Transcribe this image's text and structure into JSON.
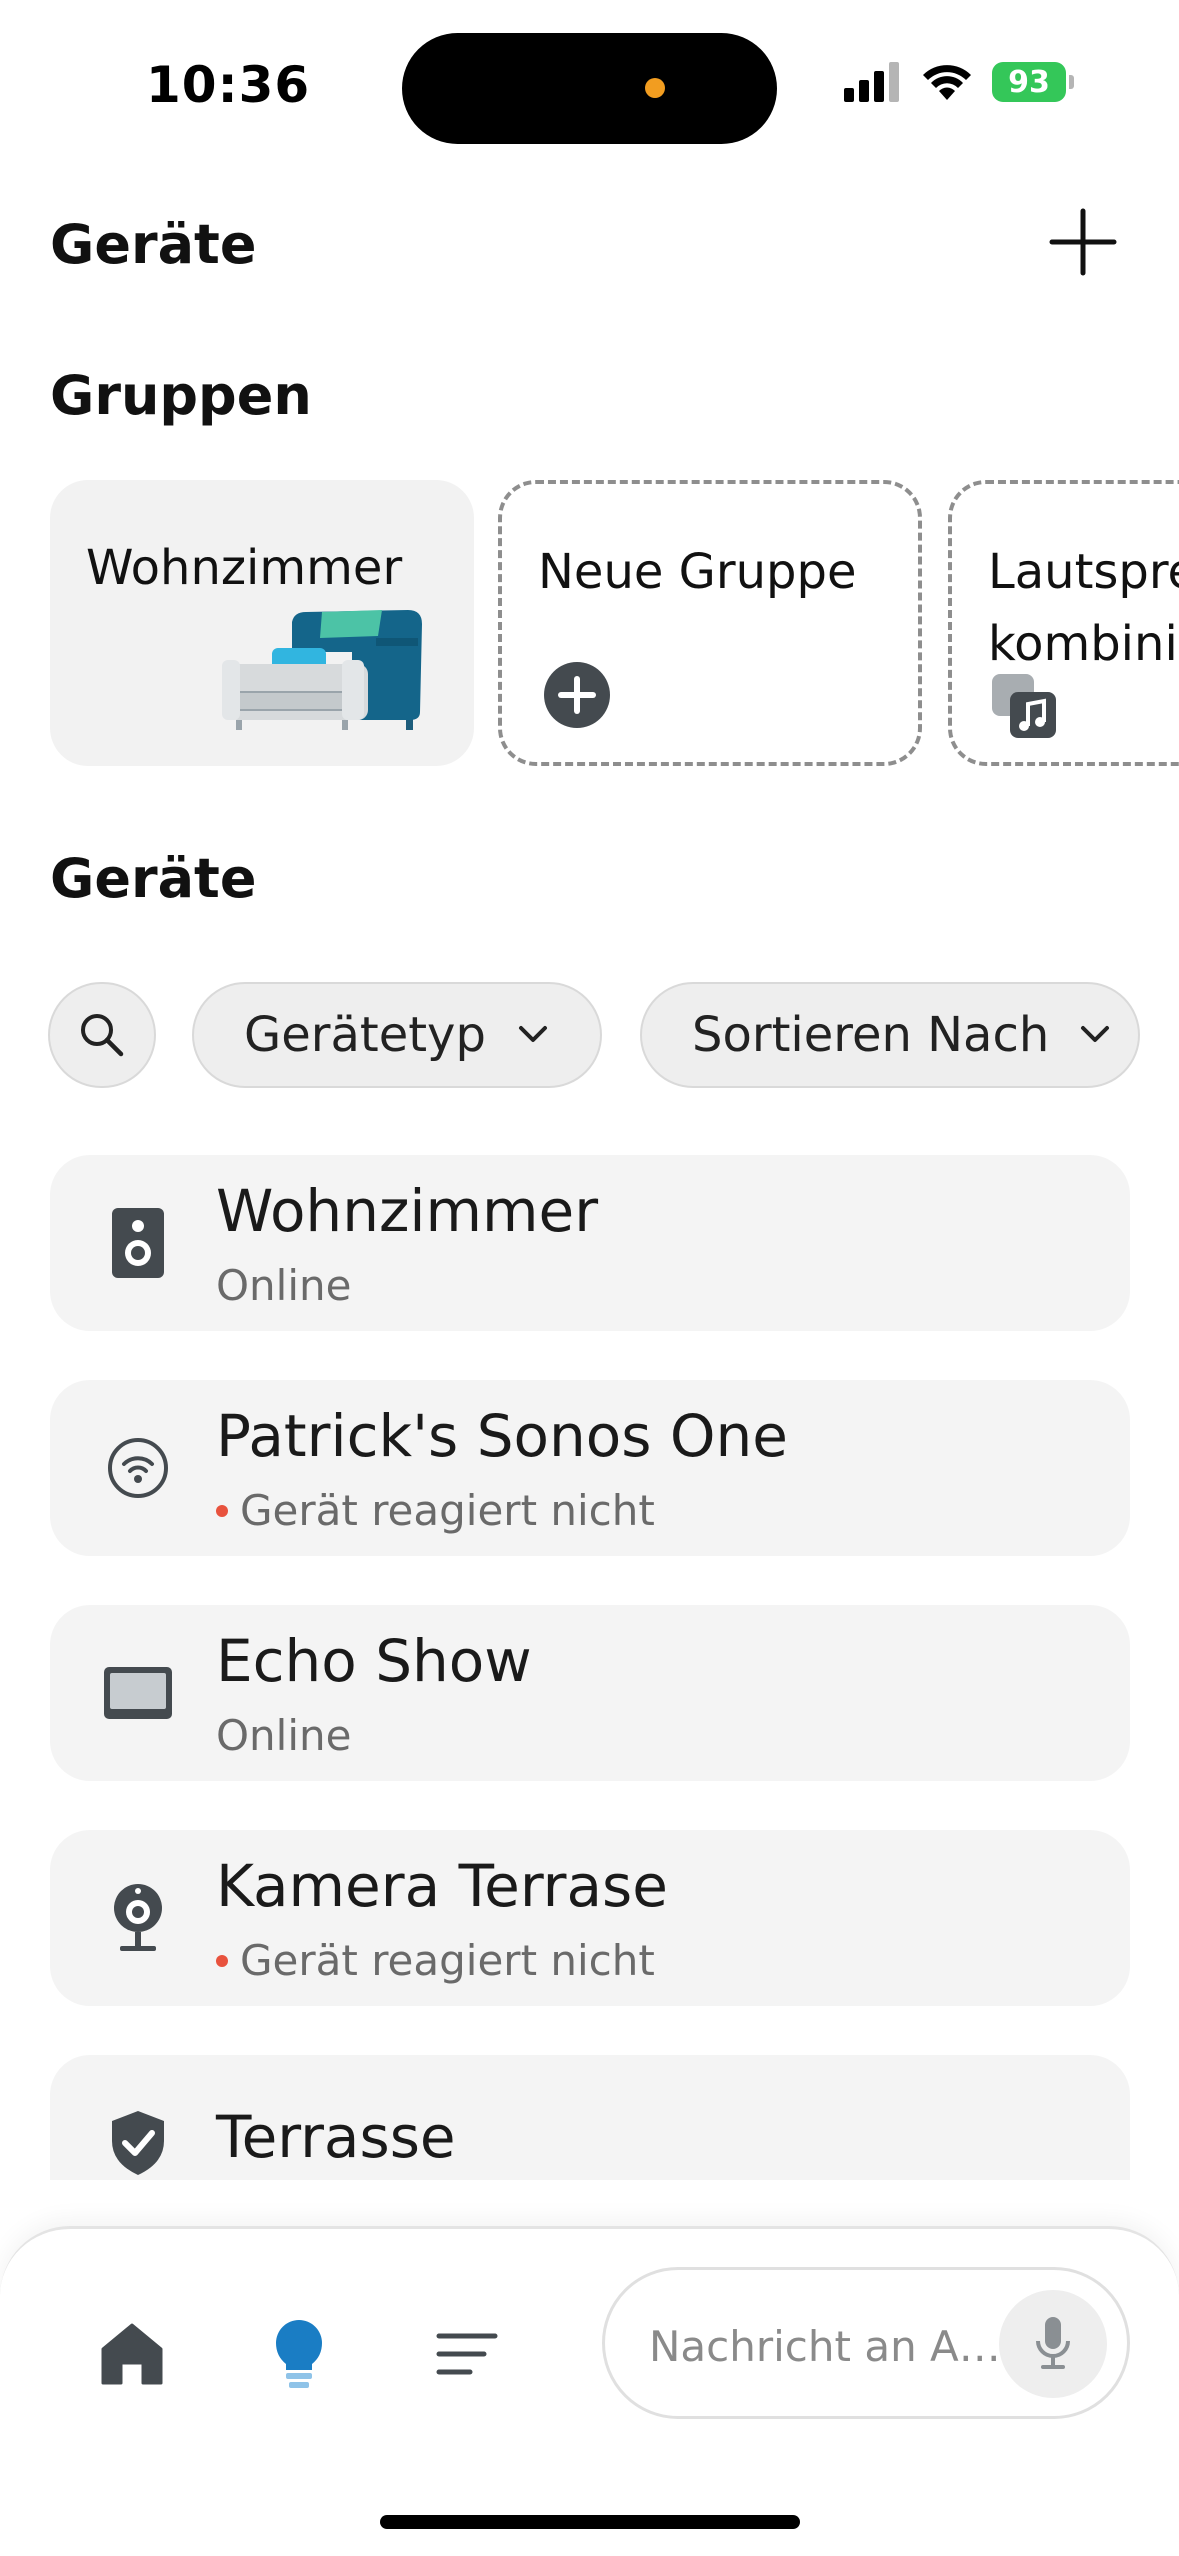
{
  "status_bar": {
    "time": "10:36",
    "battery_percent": "93",
    "signal_icon": "cellular-signal-icon",
    "wifi_icon": "wifi-icon",
    "battery_color": "#34c759"
  },
  "header": {
    "title": "Geräte",
    "add_icon": "plus-icon"
  },
  "groups": {
    "title": "Gruppen",
    "items": [
      {
        "label": "Wohnzimmer",
        "icon": "sofa-illustration"
      },
      {
        "label": "Neue Gruppe",
        "icon": "plus-circle-icon"
      },
      {
        "label": "Lautsprecher kombinieren",
        "icon": "music-note-icon"
      }
    ]
  },
  "devices": {
    "title": "Geräte",
    "filters": {
      "search_icon": "search-icon",
      "device_type": "Gerätetyp",
      "sort_by": "Sortieren Nach"
    },
    "items": [
      {
        "name": "Wohnzimmer",
        "status": "Online",
        "offline": false,
        "icon": "speaker-icon"
      },
      {
        "name": "Patrick's Sonos One",
        "status": "Gerät reagiert nicht",
        "offline": true,
        "icon": "wifi-speaker-icon"
      },
      {
        "name": "Echo Show",
        "status": "Online",
        "offline": false,
        "icon": "display-icon"
      },
      {
        "name": "Kamera Terrase",
        "status": "Gerät reagiert nicht",
        "offline": true,
        "icon": "camera-icon"
      },
      {
        "name": "Terrasse",
        "status": "",
        "offline": false,
        "icon": "shield-check-icon"
      }
    ]
  },
  "bottom_bar": {
    "message_placeholder": "Nachricht an A…",
    "active_tab": "devices",
    "accent_color": "#1a7dc4"
  }
}
